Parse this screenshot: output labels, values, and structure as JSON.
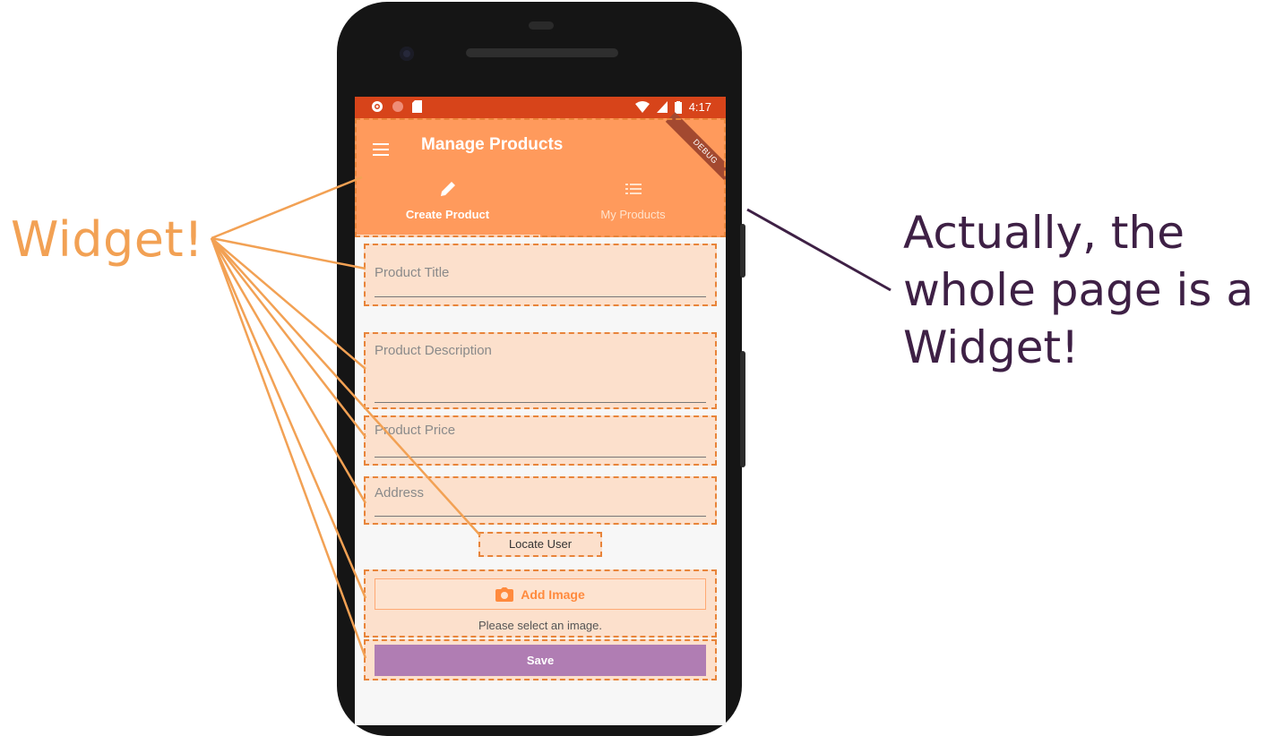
{
  "annotations": {
    "left_label": "Widget!",
    "right_label": "Actually, the whole page is a Widget!"
  },
  "status_bar": {
    "time": "4:17"
  },
  "debug_banner": "DEBUG",
  "app_bar": {
    "title": "Manage Products",
    "tabs": [
      {
        "label": "Create Product",
        "icon": "edit-icon",
        "active": true
      },
      {
        "label": "My Products",
        "icon": "list-icon",
        "active": false
      }
    ]
  },
  "form": {
    "fields": [
      {
        "label": "Product Title"
      },
      {
        "label": "Product Description"
      },
      {
        "label": "Product Price"
      },
      {
        "label": "Address"
      }
    ],
    "locate_button": "Locate User",
    "add_image_button": "Add Image",
    "image_hint": "Please select an image.",
    "save_button": "Save"
  },
  "colors": {
    "status_bar": "#d7441a",
    "app_bar": "#ff9a5c",
    "widget_highlight": "#fce0cc",
    "widget_outline": "#e8843a",
    "save_button": "#b07db3",
    "annotation_orange": "#f2a154",
    "annotation_purple": "#3e2045"
  }
}
